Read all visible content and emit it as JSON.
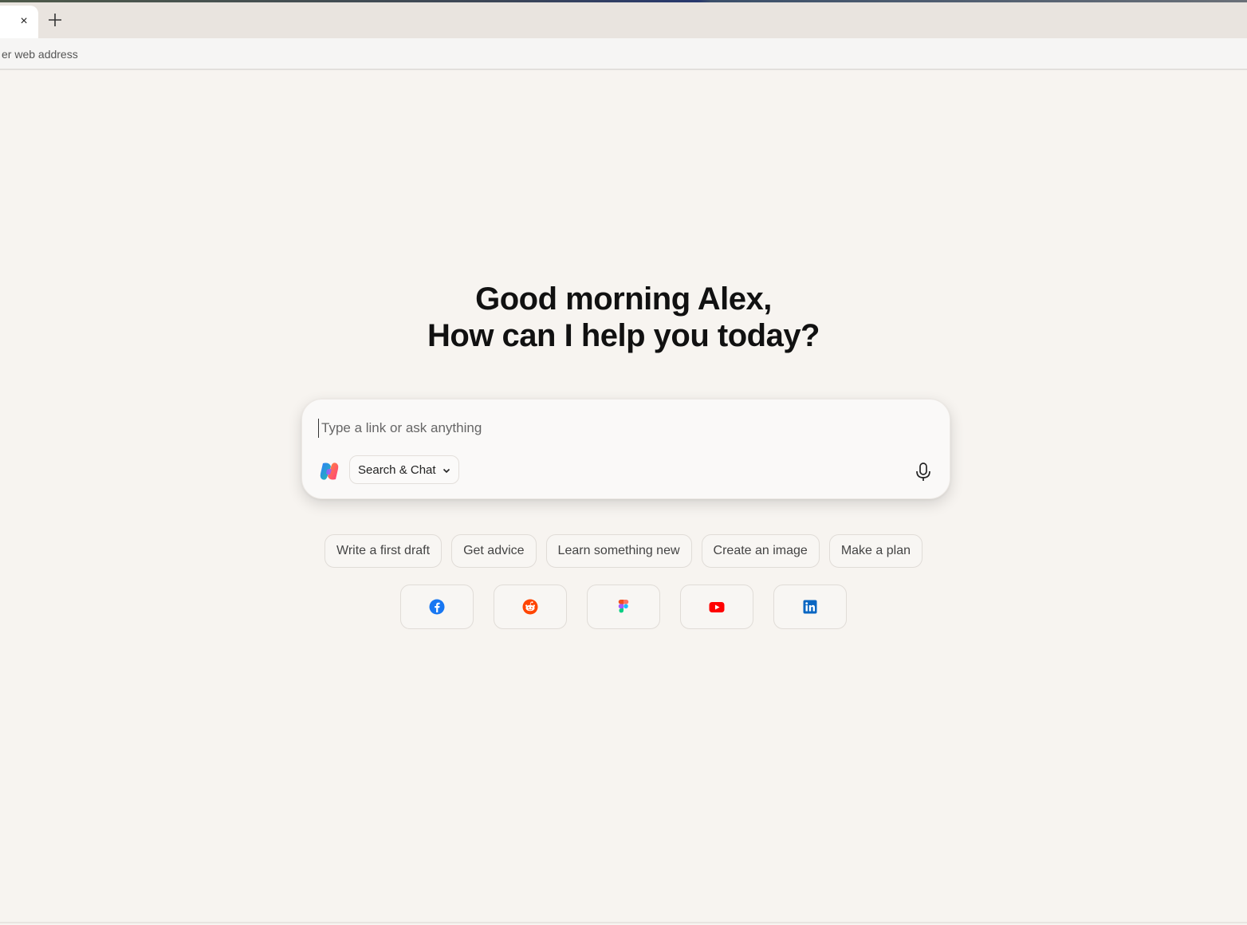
{
  "browser": {
    "tab": {
      "close_glyph": "×"
    },
    "new_tab_icon": "plus-icon",
    "address": {
      "placeholder": "er web address"
    }
  },
  "greeting": {
    "line1": "Good morning Alex,",
    "line2": "How can I help you today?"
  },
  "composer": {
    "placeholder": "Type a link or ask anything",
    "mode_label": "Search & Chat",
    "mode_icon": "chevron-down-icon",
    "mic_icon": "microphone-icon"
  },
  "suggestions": [
    "Write a first draft",
    "Get advice",
    "Learn something new",
    "Create an image",
    "Make a plan"
  ],
  "shortcuts": [
    {
      "name": "facebook",
      "icon": "facebook-icon",
      "color": "#1877f2"
    },
    {
      "name": "reddit",
      "icon": "reddit-icon",
      "color": "#ff4500"
    },
    {
      "name": "figma",
      "icon": "figma-icon",
      "color": "#a259ff"
    },
    {
      "name": "youtube",
      "icon": "youtube-icon",
      "color": "#ff0000"
    },
    {
      "name": "linkedin",
      "icon": "linkedin-icon",
      "color": "#0a66c2"
    }
  ],
  "colors": {
    "background": "#f7f4f0",
    "tabbar": "#e9e4df"
  }
}
